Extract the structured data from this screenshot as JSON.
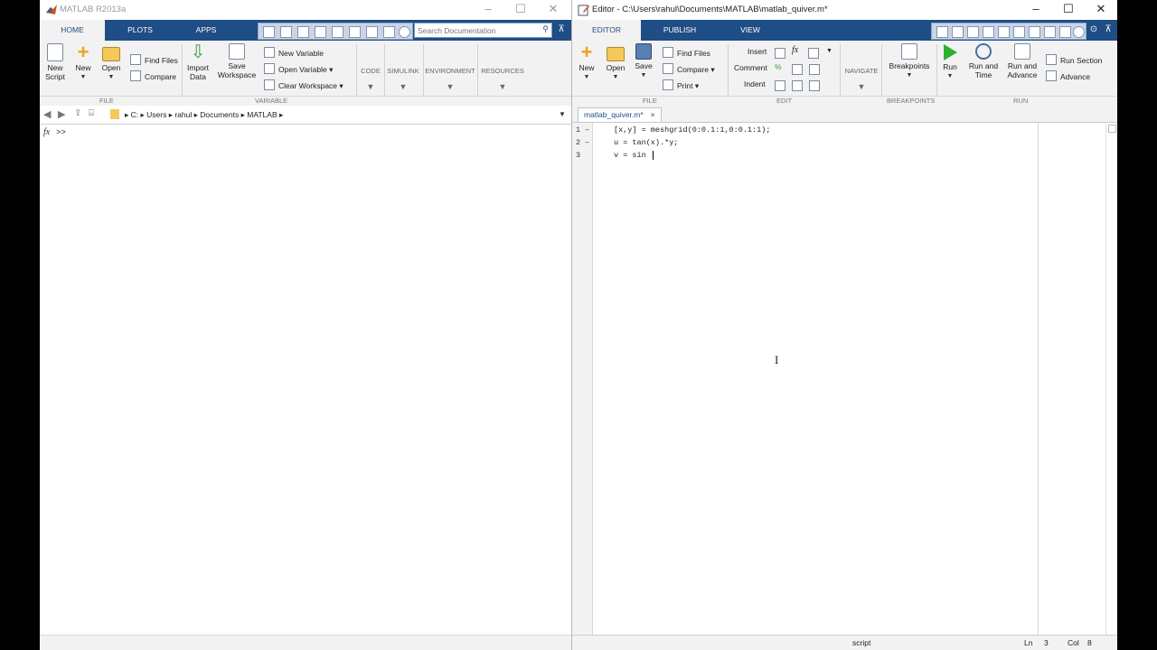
{
  "left": {
    "title": "MATLAB R2013a",
    "tabs": [
      {
        "label": "HOME",
        "active": true
      },
      {
        "label": "PLOTS",
        "active": false
      },
      {
        "label": "APPS",
        "active": false
      }
    ],
    "search_placeholder": "Search Documentation",
    "file": {
      "new_script": [
        "New",
        "Script"
      ],
      "new": "New",
      "open": "Open",
      "find_files": "Find Files",
      "compare": "Compare"
    },
    "variable": {
      "import_data": [
        "Import",
        "Data"
      ],
      "save_workspace": [
        "Save",
        "Workspace"
      ],
      "new_variable": "New Variable",
      "open_variable": "Open Variable",
      "clear_workspace": "Clear Workspace"
    },
    "sections": [
      "CODE",
      "SIMULINK",
      "ENVIRONMENT",
      "RESOURCES"
    ],
    "groups": [
      "FILE",
      "VARIABLE"
    ],
    "path": [
      "C:",
      "Users",
      "rahul",
      "Documents",
      "MATLAB"
    ],
    "prompt": ">>",
    "fx": "fx"
  },
  "right": {
    "title": "Editor - C:\\Users\\rahul\\Documents\\MATLAB\\matlab_quiver.m*",
    "tabs": [
      {
        "label": "EDITOR",
        "active": true
      },
      {
        "label": "PUBLISH",
        "active": false
      },
      {
        "label": "VIEW",
        "active": false
      }
    ],
    "file": {
      "new": "New",
      "open": "Open",
      "save": "Save",
      "find_files": "Find Files",
      "compare": "Compare",
      "print": "Print"
    },
    "edit": {
      "insert": "Insert",
      "comment": "Comment",
      "indent": "Indent"
    },
    "navigate": "NAVIGATE",
    "breakpoints": "Breakpoints",
    "run": {
      "run": "Run",
      "run_and_time": [
        "Run and",
        "Time"
      ],
      "run_and_advance": [
        "Run and",
        "Advance"
      ],
      "run_section": "Run Section",
      "advance": "Advance"
    },
    "groups": [
      "FILE",
      "EDIT",
      "BREAKPOINTS",
      "RUN"
    ],
    "doc_tab": "matlab_quiver.m*",
    "doc_tab_close": "×",
    "lines": [
      {
        "num": "1",
        "dash": "–",
        "code": "[x,y] = meshgrid(0:0.1:1,0:0.1:1);"
      },
      {
        "num": "2",
        "dash": "–",
        "code": "u = tan(x).*y;"
      },
      {
        "num": "3",
        "dash": "",
        "code": "v = sin"
      }
    ],
    "status": {
      "mode": "script",
      "ln_label": "Ln",
      "ln": "3",
      "col_label": "Col",
      "col": "8"
    }
  },
  "colors": {
    "ribbon_tab_bar": "#1f4d85",
    "ribbon_bg": "#f2f2f2",
    "run_green": "#2db02d"
  },
  "icons": [
    "matlab-logo-icon",
    "editor-icon",
    "search-icon",
    "run-icon",
    "folder-icon",
    "save-icon"
  ]
}
